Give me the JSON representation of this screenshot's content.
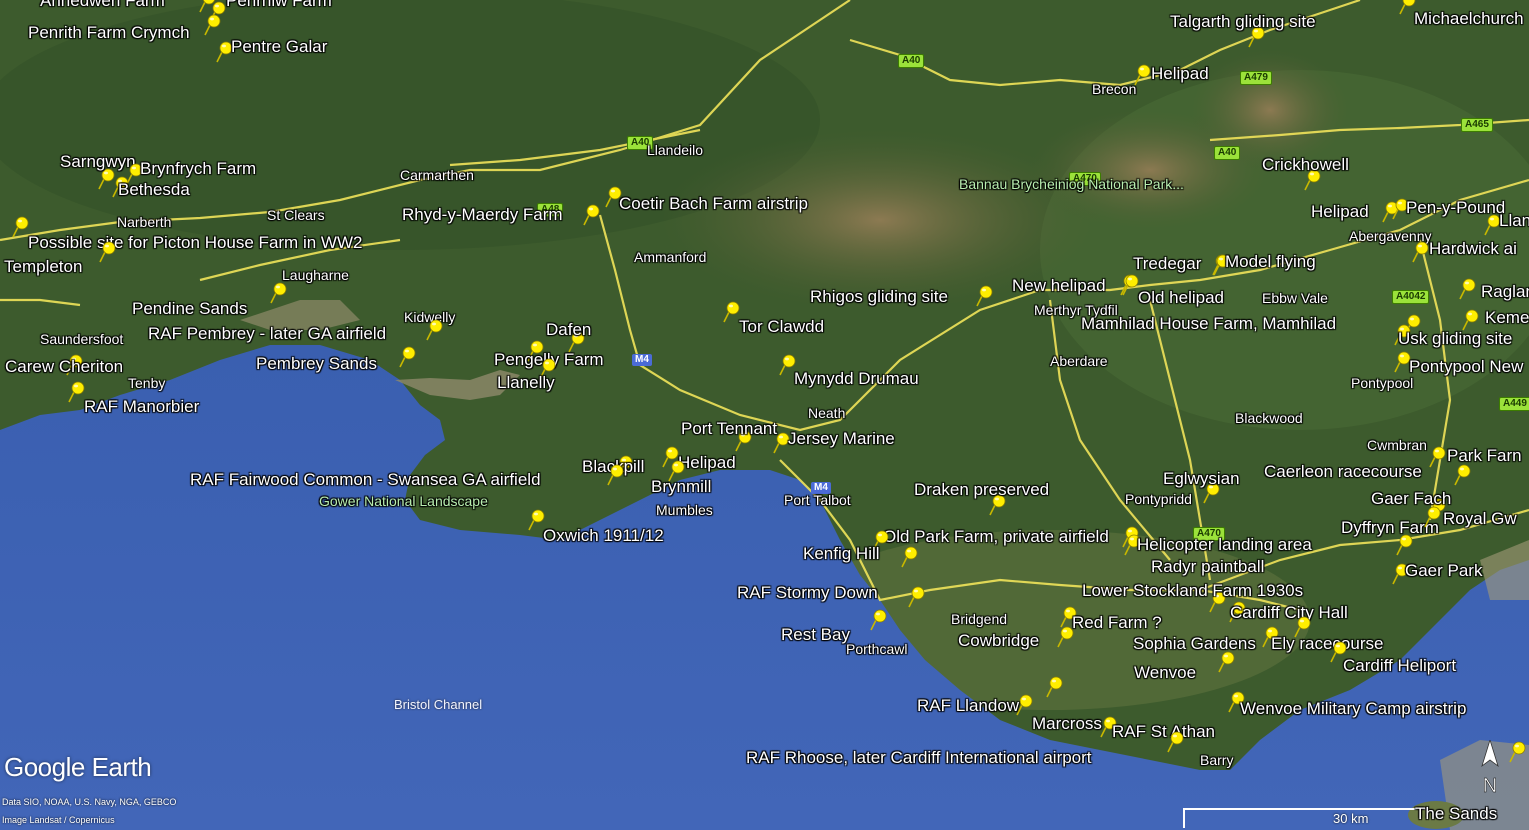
{
  "branding": {
    "name": "Google Earth",
    "credit_line_1": "Data SIO, NOAA, U.S. Navy, NGA, GEBCO",
    "credit_line_2": "Image Landsat / Copernicus"
  },
  "scale": {
    "label": "30 km"
  },
  "compass": {
    "label": "N"
  },
  "colors": {
    "sea": "#3f63b4",
    "land": "#3b5a2e",
    "road": "#f0e35a",
    "pin": "#ffee00"
  },
  "pins": [
    {
      "label": "Annedwen Farm"
    },
    {
      "label": "Penrhiw Farm"
    },
    {
      "label": "Penrith Farm Crymch"
    },
    {
      "label": "Pentre Galar"
    },
    {
      "label": "Sarngwyn"
    },
    {
      "label": "Brynfrych Farm"
    },
    {
      "label": "Bethesda"
    },
    {
      "label": "Possible site for Picton House Farm in WW2"
    },
    {
      "label": "Templeton"
    },
    {
      "label": "Pendine Sands"
    },
    {
      "label": "RAF Pembrey - later GA airfield"
    },
    {
      "label": "Pembrey Sands"
    },
    {
      "label": "Carew Cheriton"
    },
    {
      "label": "RAF Manorbier"
    },
    {
      "label": "Rhyd-y-Maerdy Farm"
    },
    {
      "label": "Coetir Bach Farm airstrip"
    },
    {
      "label": "Dafen"
    },
    {
      "label": "Pengelly Farm"
    },
    {
      "label": "Llanelly"
    },
    {
      "label": "Tor Clawdd"
    },
    {
      "label": "Mynydd Drumau"
    },
    {
      "label": "Port Tennant"
    },
    {
      "label": "Jersey Marine"
    },
    {
      "label": "Blackpill"
    },
    {
      "label": "Helipad"
    },
    {
      "label": "Brynmill"
    },
    {
      "label": "RAF Fairwood Common - Swansea GA airfield"
    },
    {
      "label": "Oxwich 1911/12"
    },
    {
      "label": "Rhigos gliding site"
    },
    {
      "label": "New helipad"
    },
    {
      "label": "Old helipad"
    },
    {
      "label": "Tredegar"
    },
    {
      "label": "Model flying"
    },
    {
      "label": "Mamhilad House Farm, Mamhilad"
    },
    {
      "label": "Usk gliding site"
    },
    {
      "label": "Pontypool New"
    },
    {
      "label": "Talgarth gliding site"
    },
    {
      "label": "Michaelchurch"
    },
    {
      "label": "Helipad"
    },
    {
      "label": "Crickhowell"
    },
    {
      "label": "Helipad"
    },
    {
      "label": "Pen-y-Pound"
    },
    {
      "label": "Llan"
    },
    {
      "label": "Hardwick ai"
    },
    {
      "label": "Raglan"
    },
    {
      "label": "Keme"
    },
    {
      "label": "Park Farn"
    },
    {
      "label": "Caerleon racecourse"
    },
    {
      "label": "Gaer Fach"
    },
    {
      "label": "Dyffryn Farm"
    },
    {
      "label": "Royal Gw"
    },
    {
      "label": "Gaer Park"
    },
    {
      "label": "Eglwysian"
    },
    {
      "label": "Draken preserved"
    },
    {
      "label": "Old Park Farm, private airfield"
    },
    {
      "label": "Helicopter landing area"
    },
    {
      "label": "Kenfig Hill"
    },
    {
      "label": "Radyr paintball"
    },
    {
      "label": "Lower Stockland Farm 1930s"
    },
    {
      "label": "RAF Stormy Down"
    },
    {
      "label": "Rest Bay"
    },
    {
      "label": "Cardiff City Hall"
    },
    {
      "label": "Red Farm ?"
    },
    {
      "label": "Cowbridge"
    },
    {
      "label": "Sophia Gardens"
    },
    {
      "label": "Ely racecourse"
    },
    {
      "label": "Wenvoe"
    },
    {
      "label": "Cardiff Heliport"
    },
    {
      "label": "RAF Llandow"
    },
    {
      "label": "Marcross"
    },
    {
      "label": "RAF St Athan"
    },
    {
      "label": "Wenvoe Military Camp airstrip"
    },
    {
      "label": "RAF Rhoose, later Cardiff International airport"
    },
    {
      "label": "The Sands"
    }
  ],
  "places": [
    {
      "label": "Llandeilo"
    },
    {
      "label": "Carmarthen"
    },
    {
      "label": "Narberth"
    },
    {
      "label": "St Clears"
    },
    {
      "label": "Laugharne"
    },
    {
      "label": "Kidwelly"
    },
    {
      "label": "Saundersfoot"
    },
    {
      "label": "Tenby"
    },
    {
      "label": "Ammanford"
    },
    {
      "label": "Neath"
    },
    {
      "label": "Port Talbot"
    },
    {
      "label": "Mumbles"
    },
    {
      "label": "Brecon"
    },
    {
      "label": "Merthyr Tydfil"
    },
    {
      "label": "Aberdare"
    },
    {
      "label": "Ebbw Vale"
    },
    {
      "label": "Abergavenny"
    },
    {
      "label": "Pontypool"
    },
    {
      "label": "Blackwood"
    },
    {
      "label": "Cwmbran"
    },
    {
      "label": "Pontypridd"
    },
    {
      "label": "Bridgend"
    },
    {
      "label": "Porthcawl"
    },
    {
      "label": "Barry"
    }
  ],
  "water": [
    {
      "label": "Bristol Channel"
    }
  ],
  "parks": [
    {
      "label": "Bannau Brycheiniog National Park..."
    },
    {
      "label": "Gower National Landscape"
    }
  ],
  "roads": [
    {
      "label": "A40"
    },
    {
      "label": "A40"
    },
    {
      "label": "A40"
    },
    {
      "label": "A48"
    },
    {
      "label": "A479"
    },
    {
      "label": "A465"
    },
    {
      "label": "A4042"
    },
    {
      "label": "A449"
    },
    {
      "label": "A470"
    },
    {
      "label": "A470"
    }
  ],
  "motorways": [
    {
      "label": "M4"
    },
    {
      "label": "M4"
    }
  ]
}
